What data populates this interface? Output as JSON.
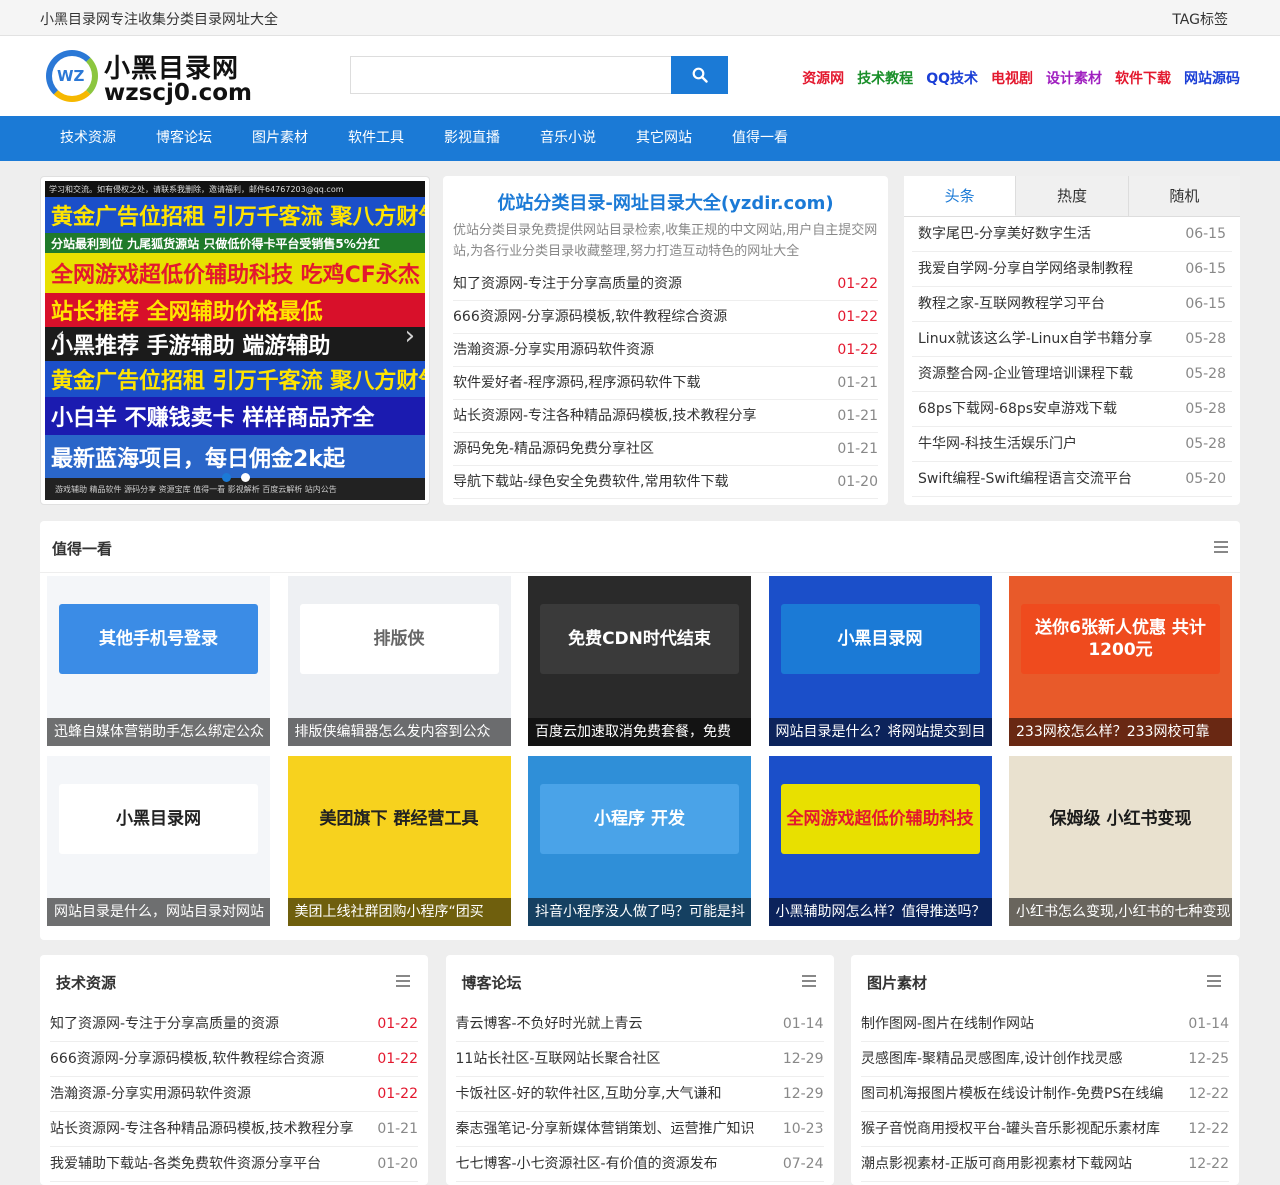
{
  "topbar": {
    "slogan": "小黑目录网专注收集分类目录网址大全",
    "tag_label": "TAG标签"
  },
  "logo": {
    "badge": "WZ",
    "cn": "小黑目录网",
    "en": "wzscj0.com"
  },
  "search": {
    "value": "",
    "placeholder": ""
  },
  "header_links": [
    {
      "label": "资源网",
      "color": "#e3182e"
    },
    {
      "label": "技术教程",
      "color": "#1a8f2a"
    },
    {
      "label": "QQ技术",
      "color": "#1b3fd6"
    },
    {
      "label": "电视剧",
      "color": "#e3182e"
    },
    {
      "label": "设计素材",
      "color": "#a020c0"
    },
    {
      "label": "软件下载",
      "color": "#e3182e"
    },
    {
      "label": "网站源码",
      "color": "#1b3fd6"
    }
  ],
  "nav": [
    "技术资源",
    "博客论坛",
    "图片素材",
    "软件工具",
    "影视直播",
    "音乐小说",
    "其它网站",
    "值得一看"
  ],
  "banner": {
    "top_text": "学习和交流。如有侵权之处，请联系我删除，邀请福利，邮件64767203@qq.com",
    "strips": [
      {
        "text": "黄金广告位招租  引万千客流  聚八方财气",
        "bg": "#1b4fc9",
        "color": "#ffe400"
      },
      {
        "text": "分站最利到位  九尾狐货源站  只做低价得卡平台受销售5%分红",
        "bg": "#1f7a2a",
        "color": "#ffffff"
      },
      {
        "text": "全网游戏超低价辅助科技  吃鸡CF永杰",
        "bg": "#e8e000",
        "color": "#e3182e"
      },
      {
        "text": "站长推荐  全网辅助价格最低",
        "bg": "#d8102a",
        "color": "#ffe400"
      },
      {
        "text": "小黑推荐  手游辅助  端游辅助",
        "bg": "#1b1b1b",
        "color": "#ffffff"
      },
      {
        "text": "黄金广告位招租  引万千客流  聚八方财气",
        "bg": "#1b4fc9",
        "color": "#ffe400"
      },
      {
        "text": "小白羊  不赚钱卖卡  样样商品齐全",
        "bg": "#1b1bb0",
        "color": "#ffffff"
      },
      {
        "text": "最新蓝海项目，每日佣金2k起",
        "bg": "#2a66c9",
        "color": "#ffffff"
      }
    ],
    "bottom_text": "游戏辅助  精品软件  源码分享  资源宝库  值得一看  影视解析  百度云解析  站内公告"
  },
  "featured": {
    "title": "优站分类目录-网址目录大全(yzdir.com)",
    "desc": "优站分类目录免费提供网站目录检索,收集正规的中文网站,用户自主提交网站,为各行业分类目录收藏整理,努力打造互动特色的网址大全",
    "items": [
      {
        "title": "知了资源网-专注于分享高质量的资源",
        "date": "01-22",
        "hot": true
      },
      {
        "title": "666资源网-分享源码模板,软件教程综合资源",
        "date": "01-22",
        "hot": true
      },
      {
        "title": "浩瀚资源-分享实用源码软件资源",
        "date": "01-22",
        "hot": true
      },
      {
        "title": "软件爱好者-程序源码,程序源码软件下载",
        "date": "01-21",
        "hot": false
      },
      {
        "title": "站长资源网-专注各种精品源码模板,技术教程分享",
        "date": "01-21",
        "hot": false
      },
      {
        "title": "源码免免-精品源码免费分享社区",
        "date": "01-21",
        "hot": false
      },
      {
        "title": "导航下载站-绿色安全免费软件,常用软件下载",
        "date": "01-20",
        "hot": false
      }
    ]
  },
  "side_tabs": {
    "tabs": [
      "头条",
      "热度",
      "随机"
    ],
    "items": [
      {
        "title": "数字尾巴-分享美好数字生活",
        "date": "06-15"
      },
      {
        "title": "我爱自学网-分享自学网络录制教程",
        "date": "06-15"
      },
      {
        "title": "教程之家-互联网教程学习平台",
        "date": "06-15"
      },
      {
        "title": "Linux就该这么学-Linux自学书籍分享",
        "date": "05-28"
      },
      {
        "title": "资源整合网-企业管理培训课程下载",
        "date": "05-28"
      },
      {
        "title": "68ps下载网-68ps安卓游戏下载",
        "date": "05-28"
      },
      {
        "title": "牛华网-科技生活娱乐门户",
        "date": "05-28"
      },
      {
        "title": "Swift编程-Swift编程语言交流平台",
        "date": "05-20"
      }
    ]
  },
  "worth": {
    "title": "值得一看",
    "cards": [
      {
        "caption": "迅蜂自媒体营销助手怎么绑定公众",
        "bg": "#f4f6f9",
        "art": "其他手机号登录",
        "art_color": "#ffffff",
        "art_bg": "#3b8ce6"
      },
      {
        "caption": "排版侠编辑器怎么发内容到公众",
        "bg": "#eef0f3",
        "art": "排版侠",
        "art_color": "#666666",
        "art_bg": "#ffffff"
      },
      {
        "caption": "百度云加速取消免费套餐，免费",
        "bg": "#2a2a2a",
        "art": "免费CDN时代结束",
        "art_color": "#ffffff",
        "art_bg": "#3a3a3a"
      },
      {
        "caption": "网站目录是什么？将网站提交到目",
        "bg": "#1b4fc9",
        "art": "小黑目录网",
        "art_color": "#ffffff",
        "art_bg": "#1b7ad6"
      },
      {
        "caption": "233网校怎么样？233网校可靠",
        "bg": "#e85a2a",
        "art": "送你6张新人优惠 共计1200元",
        "art_color": "#ffffff",
        "art_bg": "#ef4b1e"
      },
      {
        "caption": "网站目录是什么，网站目录对网站",
        "bg": "#f4f6f9",
        "art": "小黑目录网",
        "art_color": "#222222",
        "art_bg": "#ffffff"
      },
      {
        "caption": "美团上线社群团购小程序“团买",
        "bg": "#f7d21e",
        "art": "美团旗下 群经营工具",
        "art_color": "#222222",
        "art_bg": "#f7d21e"
      },
      {
        "caption": "抖音小程序没人做了吗？可能是抖",
        "bg": "#2f8fd8",
        "art": "小程序 开发",
        "art_color": "#ffffff",
        "art_bg": "#4aa3e8"
      },
      {
        "caption": "小黑辅助网怎么样？值得推送吗？",
        "bg": "#1b4fc9",
        "art": "全网游戏超低价辅助科技",
        "art_color": "#e3182e",
        "art_bg": "#e8e000"
      },
      {
        "caption": "小红书怎么变现,小红书的七种变现",
        "bg": "#e9e1cf",
        "art": "保姆级 小红书变现",
        "art_color": "#1b1b1b",
        "art_bg": "#e9e1cf"
      }
    ]
  },
  "columns": [
    {
      "title": "技术资源",
      "items": [
        {
          "title": "知了资源网-专注于分享高质量的资源",
          "date": "01-22",
          "hot": true
        },
        {
          "title": "666资源网-分享源码模板,软件教程综合资源",
          "date": "01-22",
          "hot": true
        },
        {
          "title": "浩瀚资源-分享实用源码软件资源",
          "date": "01-22",
          "hot": true
        },
        {
          "title": "站长资源网-专注各种精品源码模板,技术教程分享",
          "date": "01-21",
          "hot": false
        },
        {
          "title": "我爱辅助下载站-各类免费软件资源分享平台",
          "date": "01-20",
          "hot": false
        }
      ]
    },
    {
      "title": "博客论坛",
      "items": [
        {
          "title": "青云博客-不负好时光就上青云",
          "date": "01-14",
          "hot": false
        },
        {
          "title": "11站长社区-互联网站长聚合社区",
          "date": "12-29",
          "hot": false
        },
        {
          "title": "卡饭社区-好的软件社区,互助分享,大气谦和",
          "date": "12-29",
          "hot": false
        },
        {
          "title": "秦志强笔记-分享新媒体营销策划、运营推广知识",
          "date": "10-23",
          "hot": false
        },
        {
          "title": "七七博客-小七资源社区-有价值的资源发布",
          "date": "07-24",
          "hot": false
        }
      ]
    },
    {
      "title": "图片素材",
      "items": [
        {
          "title": "制作图网-图片在线制作网站",
          "date": "01-14",
          "hot": false
        },
        {
          "title": "灵感图库-聚精品灵感图库,设计创作找灵感",
          "date": "12-25",
          "hot": false
        },
        {
          "title": "图司机海报图片模板在线设计制作-免费PS在线编",
          "date": "12-22",
          "hot": false
        },
        {
          "title": "猴子音悦商用授权平台-罐头音乐影视配乐素材库",
          "date": "12-22",
          "hot": false
        },
        {
          "title": "潮点影视素材-正版可商用影视素材下载网站",
          "date": "12-22",
          "hot": false
        }
      ]
    }
  ]
}
